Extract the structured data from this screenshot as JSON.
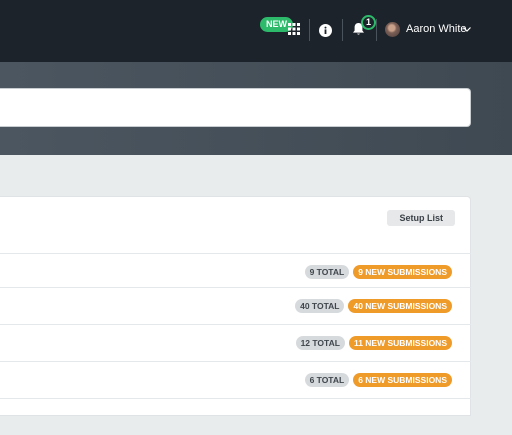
{
  "topbar": {
    "new_badge": "NEW",
    "apps_icon": "grid-icon",
    "info_icon": "info-icon",
    "bell_icon": "bell-icon",
    "notification_count": "1",
    "user_name": "Aaron White",
    "accent_color": "#2dba6b"
  },
  "card": {
    "setup_button": "Setup List",
    "rows": [
      {
        "total": "9 TOTAL",
        "new": "9 NEW SUBMISSIONS"
      },
      {
        "total": "40 TOTAL",
        "new": "40 NEW SUBMISSIONS"
      },
      {
        "total": "12 TOTAL",
        "new": "11 NEW SUBMISSIONS"
      },
      {
        "total": "6 TOTAL",
        "new": "6 NEW SUBMISSIONS"
      }
    ],
    "new_pill_color": "#ef9b2a"
  }
}
